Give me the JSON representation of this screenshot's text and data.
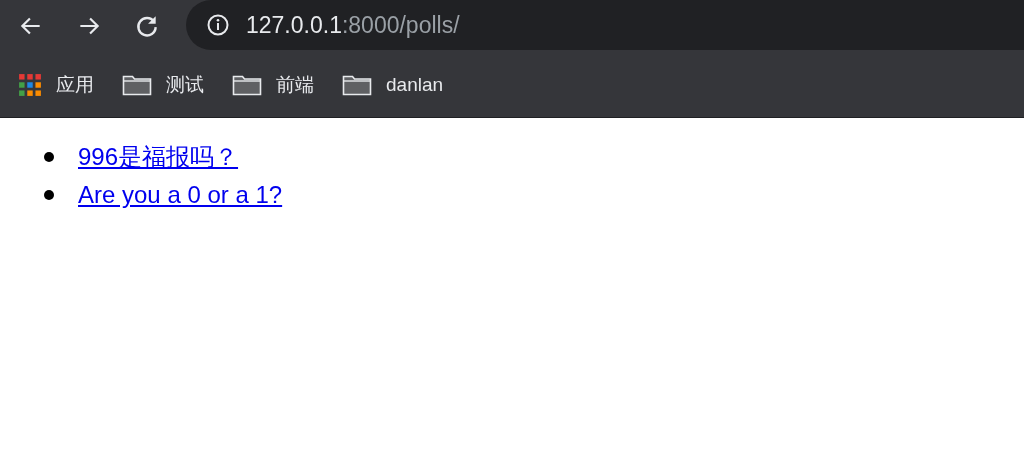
{
  "toolbar": {
    "address": {
      "host": "127.0.0.1",
      "rest": ":8000/polls/"
    }
  },
  "bookmarks": [
    {
      "kind": "apps",
      "label": "应用"
    },
    {
      "kind": "folder",
      "label": "测试"
    },
    {
      "kind": "folder",
      "label": "前端"
    },
    {
      "kind": "folder",
      "label": "danlan"
    }
  ],
  "links": [
    "996是福报吗？",
    "Are you a 0 or a 1?"
  ]
}
